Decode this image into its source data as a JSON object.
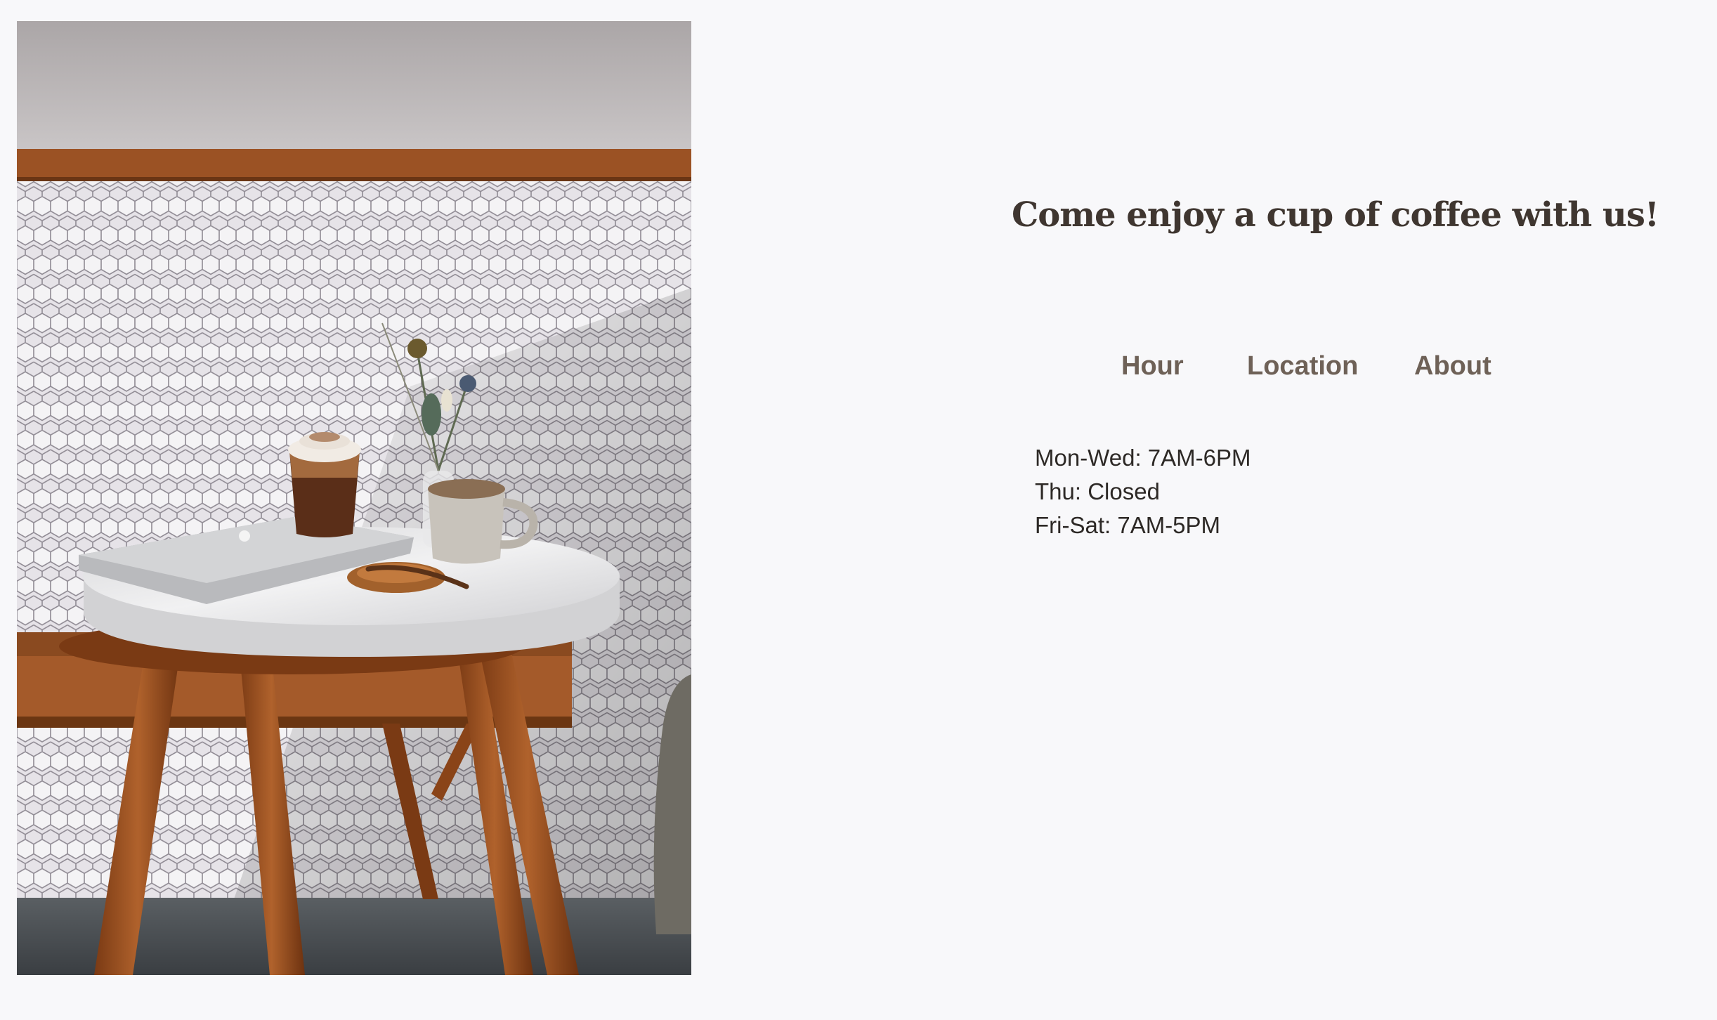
{
  "page": {
    "headline": "Come enjoy a cup of coffee with us!"
  },
  "hero_image": {
    "description_icon": "cafe-table-photo"
  },
  "tabs": [
    {
      "label": "Hour"
    },
    {
      "label": "Location"
    },
    {
      "label": "About"
    }
  ],
  "hours": [
    "Mon-Wed: 7AM-6PM",
    "Thu: Closed",
    "Fri-Sat: 7AM-5PM"
  ],
  "colors": {
    "background": "#f8f8fa",
    "headline": "#3f3630",
    "tab_text": "#6e6157",
    "body_text": "#2d2926"
  }
}
